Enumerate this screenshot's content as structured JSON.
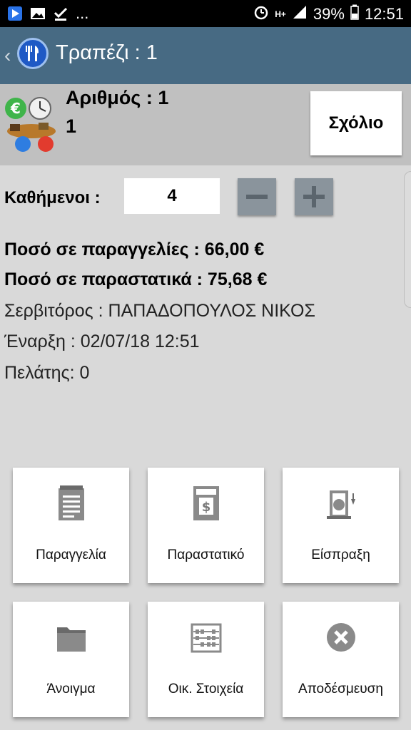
{
  "status_bar": {
    "time": "12:51",
    "battery": "39%",
    "network": "H+",
    "overflow": "...",
    "icons": [
      "play-store-icon",
      "gallery-icon",
      "checkmark-icon",
      "alarm-icon",
      "signal-icon",
      "battery-icon"
    ]
  },
  "app_bar": {
    "title": "Τραπέζι : 1",
    "back": "‹"
  },
  "header": {
    "number_line": "Αριθμός : 1",
    "number_value": "1",
    "comment_button": "Σχόλιο"
  },
  "seated": {
    "label": "Καθήμενοι :",
    "value": "4"
  },
  "info": {
    "orders_amount": "Ποσό σε παραγγελίες : 66,00 €",
    "receipts_amount": "Ποσό σε παραστατικά : 75,68 €",
    "waiter": "Σερβιτόρος : ΠΑΠΑΔΟΠΟΥΛΟΣ ΝΙΚΟΣ",
    "start": "Έναρξη : 02/07/18 12:51",
    "customer": "Πελάτης: 0"
  },
  "tiles": [
    {
      "label": "Παραγγελία",
      "icon": "notepad-icon"
    },
    {
      "label": "Παραστατικό",
      "icon": "receipt-icon"
    },
    {
      "label": "Είσπραξη",
      "icon": "cash-register-icon"
    },
    {
      "label": "Άνοιγμα",
      "icon": "folder-icon"
    },
    {
      "label": "Οικ. Στοιχεία",
      "icon": "abacus-icon"
    },
    {
      "label": "Αποδέσμευση",
      "icon": "close-circle-icon"
    }
  ],
  "colors": {
    "app_bar": "#476a83",
    "header_bg": "#c0c0c0",
    "page_bg": "#d9d9d9",
    "stepper": "#8a949c"
  }
}
